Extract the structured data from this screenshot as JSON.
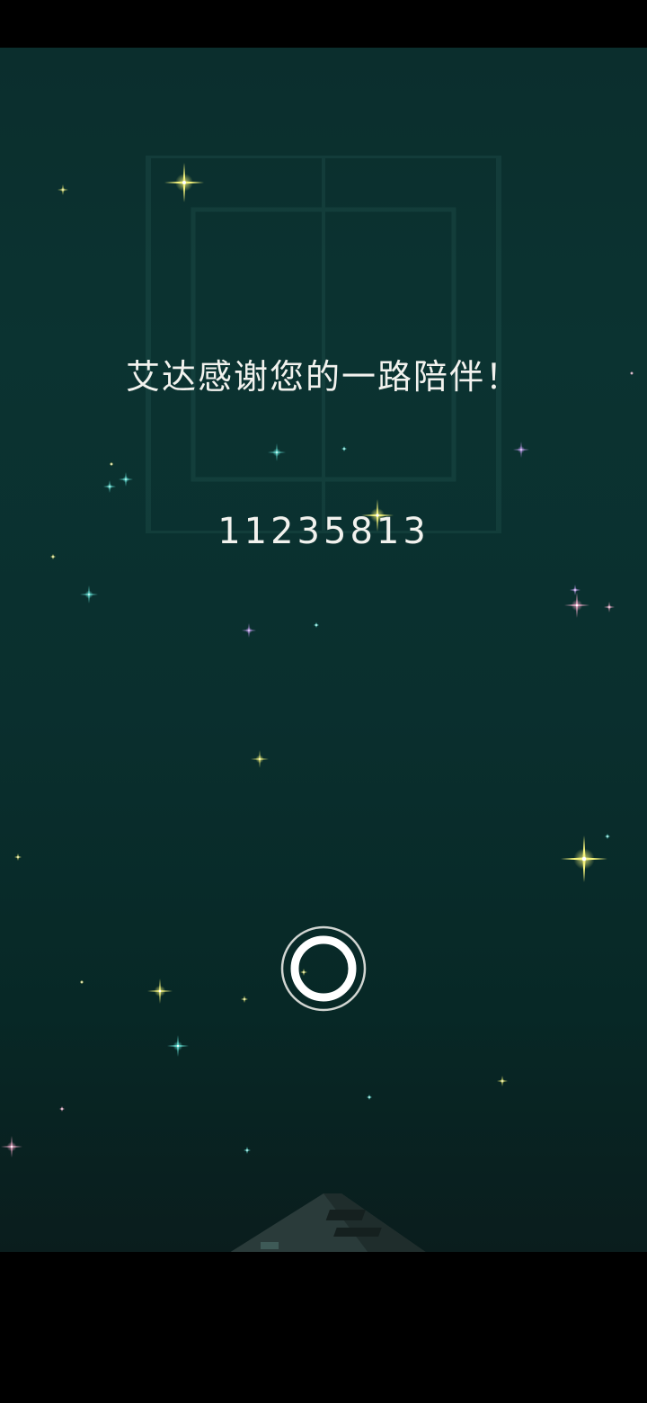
{
  "screen": {
    "message": "艾达感谢您的一路陪伴！",
    "number": "11235813"
  },
  "colors": {
    "background_top": "#0b2e2d",
    "background_bottom": "#0a1d1d",
    "text": "#f2f2ee",
    "star_yellow": "#f4f27a",
    "star_cyan": "#6ff2e6",
    "star_pink": "#f0a9c8",
    "star_violet": "#c9a0f5"
  },
  "icons": {
    "continue_button": "ring-icon",
    "structure": "monument-tower-icon"
  }
}
